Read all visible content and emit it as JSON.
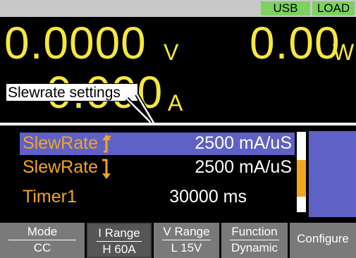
{
  "status": {
    "usb": "USB",
    "load": "LOAD"
  },
  "meter": {
    "voltage_value": "0.0000",
    "voltage_unit": "V",
    "power_value": "0.00",
    "power_unit": "W",
    "current_value": "0.000",
    "current_unit": "A"
  },
  "callout": "Slewrate settings",
  "params": [
    {
      "label": "SlewRate",
      "value": "2500 mA/uS",
      "selected": true
    },
    {
      "label": "SlewRate",
      "value": "2500 mA/uS",
      "selected": false
    },
    {
      "label": "Timer1",
      "value": "30000 ms",
      "selected": false
    }
  ],
  "softkeys": [
    {
      "top": "Mode",
      "bottom": "CC"
    },
    {
      "top": "I Range",
      "bottom": "H 60A"
    },
    {
      "top": "V Range",
      "bottom": "L 15V"
    },
    {
      "top": "Function",
      "bottom": "Dynamic"
    },
    {
      "top": "Configure"
    }
  ],
  "colors": {
    "meter_yellow": "#f6e83c",
    "param_orange": "#f4a51e",
    "selection_blue": "#5f61c6",
    "status_green": "#7cd160"
  }
}
